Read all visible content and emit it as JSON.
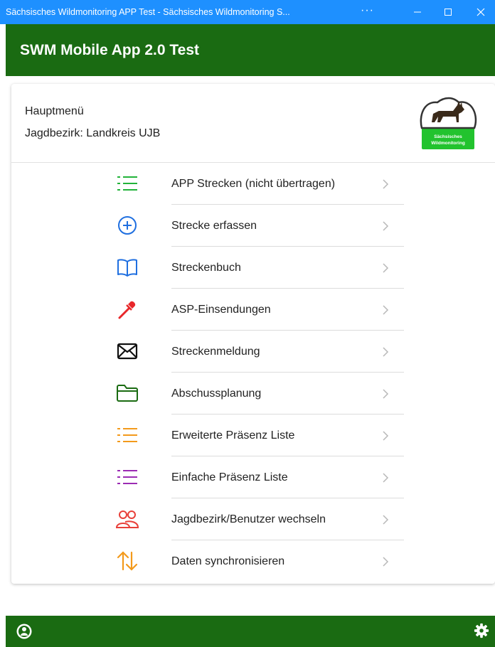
{
  "window": {
    "title": "Sächsisches Wildmonitoring APP Test - Sächsisches Wildmonitoring S...",
    "more": "···"
  },
  "appbar": {
    "title": "SWM Mobile App 2.0 Test"
  },
  "header": {
    "line1": "Hauptmenü",
    "line2": "Jagdbezirk: Landkreis UJB",
    "logo_text": "Sächsisches Wildmonitoring",
    "logo_color": "#22c32e"
  },
  "menu": [
    {
      "label": "APP Strecken (nicht übertragen)",
      "icon": "list-icon",
      "color": "#22b33a"
    },
    {
      "label": "Strecke erfassen",
      "icon": "add-circle-icon",
      "color": "#1f6fe0"
    },
    {
      "label": "Streckenbuch",
      "icon": "book-icon",
      "color": "#1f6fe0"
    },
    {
      "label": "ASP-Einsendungen",
      "icon": "pipette-icon",
      "color": "#e8272a"
    },
    {
      "label": "Streckenmeldung",
      "icon": "mail-icon",
      "color": "#111111"
    },
    {
      "label": "Abschussplanung",
      "icon": "folder-icon",
      "color": "#1a6b12"
    },
    {
      "label": "Erweiterte Präsenz Liste",
      "icon": "list-icon",
      "color": "#f39a1b"
    },
    {
      "label": "Einfache Präsenz Liste",
      "icon": "list-icon",
      "color": "#9b2bb3"
    },
    {
      "label": "Jagdbezirk/Benutzer wechseln",
      "icon": "users-icon",
      "color": "#e8403a"
    },
    {
      "label": "Daten synchronisieren",
      "icon": "sync-arrows-icon",
      "color": "#f39a1b"
    }
  ],
  "colors": {
    "titlebar": "#1e90ff",
    "appbar": "#1a6b12",
    "chevron": "#b8b8b8"
  }
}
